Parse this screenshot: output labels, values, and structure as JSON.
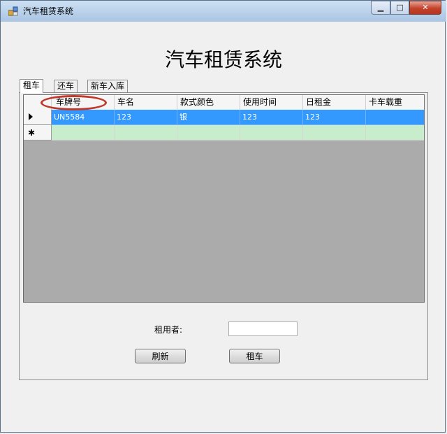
{
  "window": {
    "title": "汽车租赁系统"
  },
  "page_title": "汽车租赁系统",
  "tabs": [
    {
      "label": "租车",
      "active": true
    },
    {
      "label": "还车",
      "active": false
    },
    {
      "label": "新车入库",
      "active": false
    }
  ],
  "grid": {
    "columns": [
      "车牌号",
      "车名",
      "款式颜色",
      "使用时间",
      "日租金",
      "卡车载重"
    ],
    "rows": [
      {
        "indicator": "▸",
        "cells": [
          "UN5584",
          "123",
          "银",
          "123",
          "123",
          ""
        ],
        "selected": true
      },
      {
        "indicator": "✱",
        "cells": [
          "",
          "",
          "",
          "",
          "",
          ""
        ],
        "new_row": true
      }
    ]
  },
  "form": {
    "renter_label": "租用者:",
    "renter_value": "",
    "refresh_button": "刷新",
    "rent_button": "租车"
  },
  "colors": {
    "selection": "#3399ff",
    "new_row": "#c7edcc",
    "grid_background": "#ababab",
    "highlight_circle": "#c0392b"
  }
}
